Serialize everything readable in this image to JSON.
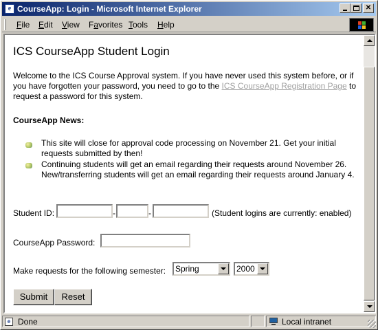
{
  "window": {
    "title": "CourseApp: Login - Microsoft Internet Explorer",
    "app_icon": "ie-icon"
  },
  "menu": {
    "items": [
      {
        "label": "File",
        "accel": "F",
        "rest": "ile"
      },
      {
        "label": "Edit",
        "accel": "E",
        "rest": "dit"
      },
      {
        "label": "View",
        "accel": "V",
        "rest": "iew"
      },
      {
        "label": "Favorites",
        "accel": "a",
        "pre": "F",
        "rest": "vorites"
      },
      {
        "label": "Tools",
        "accel": "T",
        "rest": "ools"
      },
      {
        "label": "Help",
        "accel": "H",
        "rest": "elp"
      }
    ]
  },
  "page": {
    "title": "ICS CourseApp Student Login",
    "intro_before": "Welcome to the ICS Course Approval system.  If you have never used this system before, or if you have forgotten your password, you need to go to the ",
    "intro_link": "ICS CourseApp Registration Page",
    "intro_after": " to request a password for this system.",
    "news_heading": "CourseApp News:",
    "news": [
      "This site will close for approval code processing on November 21.  Get your initial requests submitted by then!",
      "Continuing students will get an email regarding their requests around November 26.  New/transferring students will get an email regarding their requests around January 4."
    ]
  },
  "form": {
    "student_id_label": "Student ID:",
    "id_sep": "-",
    "student_login_status": "(Student logins are currently: enabled)",
    "password_label": "CourseApp Password:",
    "semester_label": "Make requests for the following semester:",
    "semester_value": "Spring",
    "year_value": "2000",
    "submit_label": "Submit",
    "reset_label": "Reset"
  },
  "status": {
    "text": "Done",
    "zone": "Local intranet"
  },
  "colors": {
    "titlebar_start": "#0a246a",
    "titlebar_end": "#a6caf0",
    "chrome": "#d4d0c8",
    "visited_link": "#a0a0a0"
  }
}
